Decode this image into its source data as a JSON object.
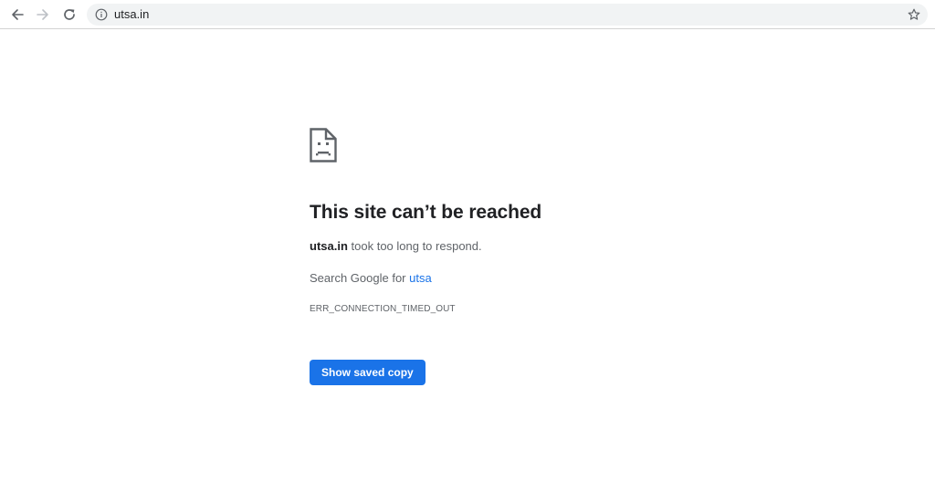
{
  "toolbar": {
    "back_icon": "arrow-left-icon",
    "forward_icon": "arrow-right-icon",
    "reload_icon": "reload-icon",
    "omnibox": {
      "security_icon": "info-icon",
      "url": "utsa.in",
      "bookmark_icon": "star-outline-icon"
    }
  },
  "error_page": {
    "icon": "sad-page-icon",
    "headline": "This site can’t be reached",
    "message_host": "utsa.in",
    "message_text": " took too long to respond.",
    "suggestion_prefix": "Search Google for ",
    "suggestion_link": "utsa",
    "error_code": "ERR_CONNECTION_TIMED_OUT",
    "saved_copy_button": "Show saved copy"
  },
  "colors": {
    "accent_blue": "#1a73e8",
    "text_primary": "#202124",
    "text_secondary": "#5f6368",
    "omnibox_bg": "#f1f3f4",
    "toolbar_border": "#d3d3d3"
  }
}
